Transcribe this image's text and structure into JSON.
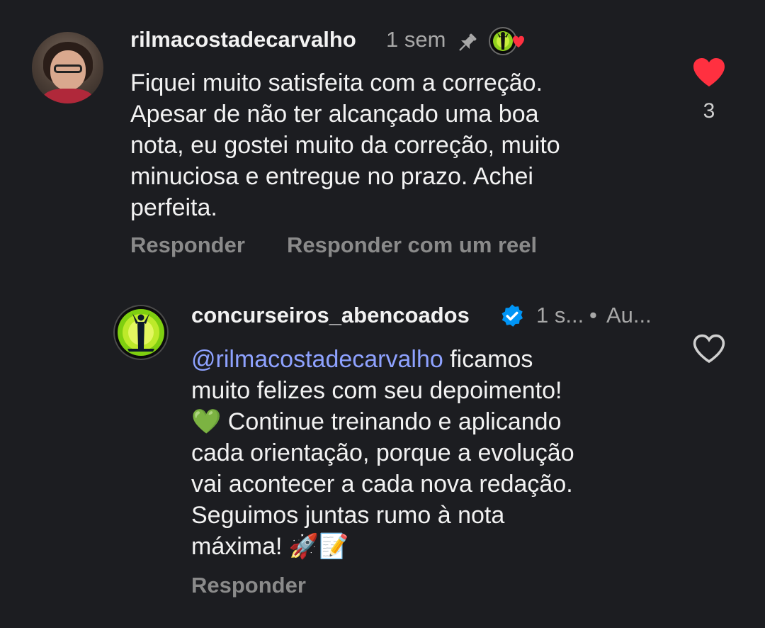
{
  "comment": {
    "username": "rilmacostadecarvalho",
    "time": "1 sem",
    "text": "Fiquei muito satisfeita com a correção.\nApesar de não ter alcançado uma boa\nnota, eu  gostei muito da correção, muito\nminuciosa e entregue no prazo. Achei\nperfeita.",
    "like_count": "3",
    "actions": [
      "Responder",
      "Responder com um reel"
    ],
    "liked": true,
    "pinned": true
  },
  "reply": {
    "username": "concurseiros_abencoados",
    "verified": true,
    "time": "1 s...",
    "separator": "•",
    "author_label": "Au...",
    "mention": "@rilmacostadecarvalho",
    "text_first": " ficamos\nmuito felizes com seu depoimento!\n",
    "emoji_heart": "💚",
    "text_middle": " Continue treinando e aplicando\ncada orientação, porque a evolução\nvai acontecer a cada nova redação.\nSeguimos juntas rumo à nota\nmáxima! ",
    "emoji_end": "🚀📝",
    "action": "Responder",
    "liked": false
  },
  "colors": {
    "background": "#1c1d21",
    "like_red": "#ff3040",
    "mention_blue": "#8ea2ff",
    "verified_blue": "#0095f6",
    "secondary_text": "#a8a8a8"
  },
  "icons": [
    "pin-icon",
    "creator-heart-icon",
    "heart-filled-icon",
    "verified-badge-icon",
    "heart-outline-icon"
  ]
}
